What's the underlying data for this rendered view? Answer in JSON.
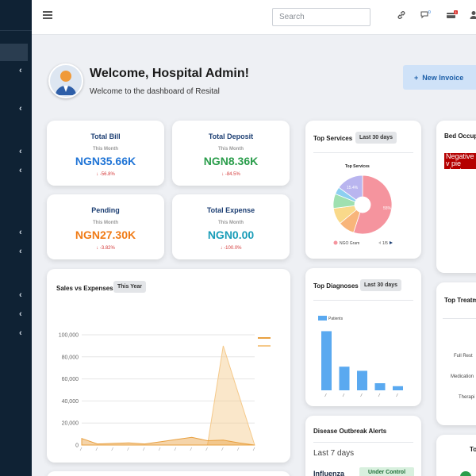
{
  "topbar": {
    "search_placeholder": "Search",
    "message_badge": "0",
    "card_badge": "5"
  },
  "welcome": {
    "title": "Welcome, Hospital Admin!",
    "subtitle": "Welcome to the dashboard of Resital",
    "new_invoice_label": "New Invoice"
  },
  "stats": [
    {
      "title": "Total Bill",
      "period": "This Month",
      "value": "NGN35.66K",
      "change": "-56.8%",
      "color": "#1f74d6"
    },
    {
      "title": "Total Deposit",
      "period": "This Month",
      "value": "NGN8.36K",
      "change": "-84.5%",
      "color": "#2a9d4b"
    },
    {
      "title": "Pending",
      "period": "This Month",
      "value": "NGN27.30K",
      "change": "-3.82%",
      "color": "#f07b16"
    },
    {
      "title": "Total Expense",
      "period": "This Month",
      "value": "NGN0.00",
      "change": "-100.0%",
      "color": "#1a9db8"
    }
  ],
  "sales": {
    "title": "Sales vs Expenses",
    "filter": "This Year",
    "chart_data": {
      "type": "area",
      "ylim": [
        0,
        100000
      ],
      "yticks": [
        "0",
        "20,000",
        "40,000",
        "60,000",
        "80,000",
        "100,000"
      ],
      "series": [
        {
          "values": [
            6000,
            1000,
            1500,
            2000,
            1000,
            3000,
            5000,
            7000,
            4000,
            4500,
            2000,
            0
          ],
          "color": "#e8a040"
        },
        {
          "values": [
            0,
            0,
            0,
            0,
            0,
            0,
            0,
            0,
            0,
            90000,
            45000,
            0
          ],
          "color": "#f5c98a"
        }
      ]
    }
  },
  "top_services": {
    "title": "Top Services",
    "filter": "Last 30 days",
    "chart_data": {
      "type": "pie",
      "title": "Top Services",
      "slices": [
        {
          "label": "",
          "value": 55,
          "color": "#f5949e"
        },
        {
          "label": "",
          "value": 9,
          "color": "#f8b57a"
        },
        {
          "label": "",
          "value": 9,
          "color": "#f9d98a"
        },
        {
          "label": "",
          "value": 8,
          "color": "#9fe0b0"
        },
        {
          "label": "",
          "value": 4,
          "color": "#8ccff0"
        },
        {
          "label": "",
          "value": 15,
          "color": "#b9b5ef"
        }
      ],
      "data_labels": [
        "55%",
        "15.4%"
      ],
      "legend_item": "NGO Gram",
      "legend_page": "1/5"
    }
  },
  "top_diagnoses": {
    "title": "Top Diagnoses",
    "filter": "Last 30 days",
    "chart_data": {
      "type": "bar",
      "legend": "Patients",
      "values": [
        100,
        40,
        33,
        12,
        7
      ],
      "ylim": [
        0,
        110
      ],
      "color": "#5aa9f0"
    }
  },
  "disease_alerts": {
    "title": "Disease Outbreak Alerts",
    "period": "Last 7 days",
    "item": "Influenza",
    "status": "Under Control"
  },
  "bed_occupancy": {
    "title": "Bed Occupa",
    "error": "Negative v pie chart."
  },
  "top_treatments": {
    "title": "Top Treatm",
    "labels": [
      "Full Rest",
      "Medication",
      "Therapi"
    ]
  },
  "partial_card": {
    "title": "To"
  }
}
